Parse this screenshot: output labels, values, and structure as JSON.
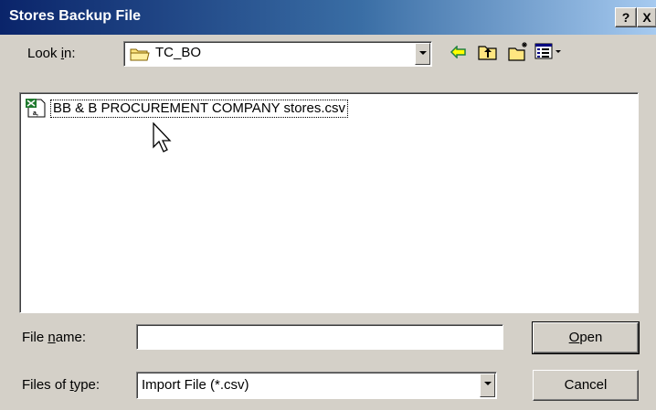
{
  "window": {
    "title": "Stores Backup File",
    "help_label": "?",
    "close_label": "X"
  },
  "lookin": {
    "label_pre": "Look ",
    "label_ul": "i",
    "label_post": "n:",
    "value": "TC_BO"
  },
  "toolbar": {
    "icons": [
      "back-arrow-icon",
      "up-folder-icon",
      "new-folder-icon",
      "view-menu-icon"
    ]
  },
  "files": [
    {
      "name": "BB & B PROCUREMENT COMPANY stores.csv",
      "icon": "excel-csv-file-icon"
    }
  ],
  "filename": {
    "label_pre": "File ",
    "label_ul": "n",
    "label_post": "ame:",
    "value": ""
  },
  "filetype": {
    "label_pre": "Files of ",
    "label_ul": "t",
    "label_post": "ype:",
    "value": "Import File (*.csv)"
  },
  "buttons": {
    "open_ul": "O",
    "open_rest": "pen",
    "cancel": "Cancel"
  }
}
